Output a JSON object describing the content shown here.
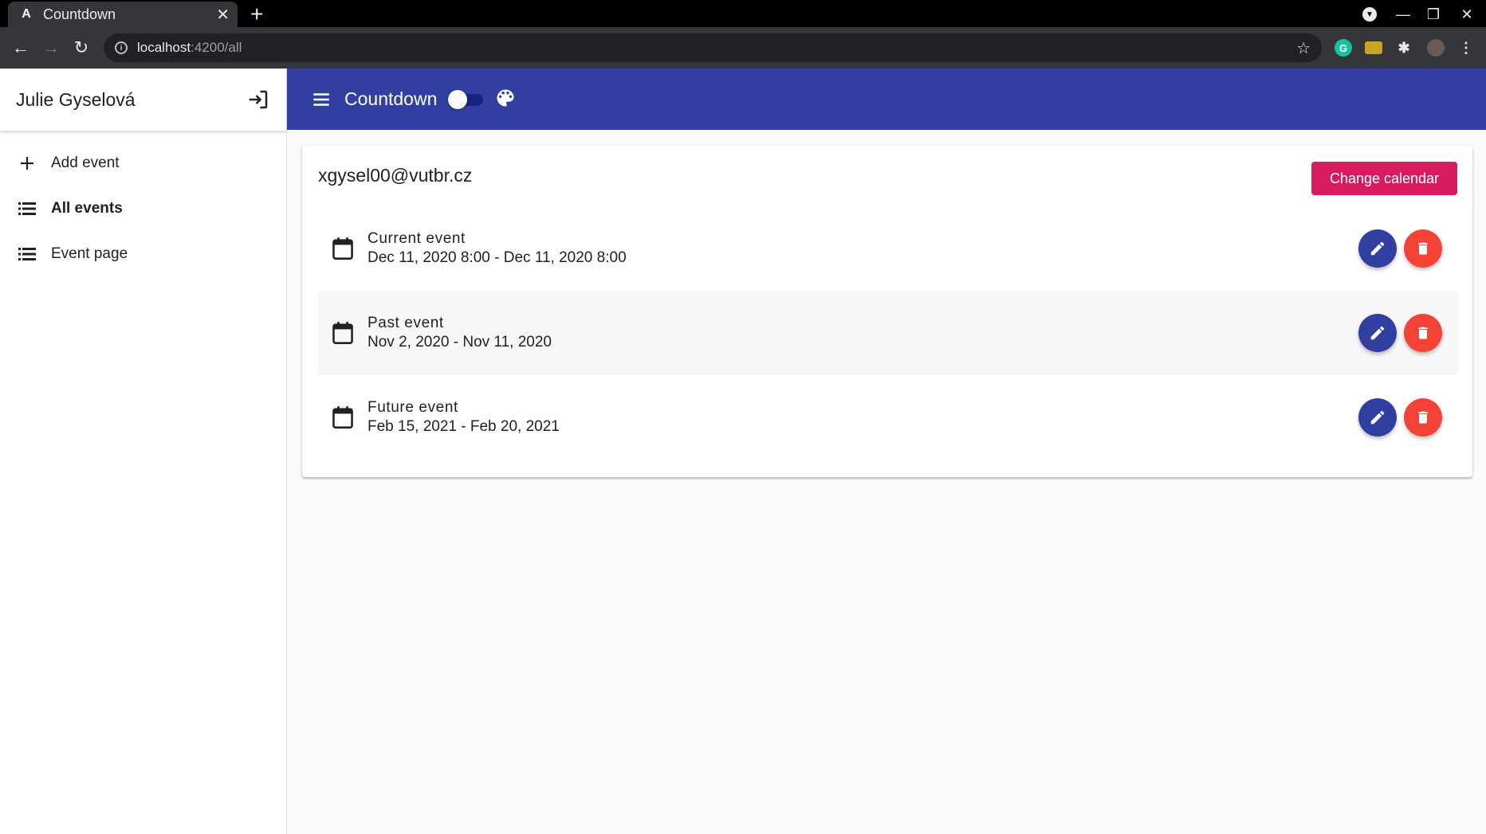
{
  "browser": {
    "tab_title": "Countdown",
    "tab_favicon": "A",
    "url_host": "localhost",
    "url_path": ":4200/all"
  },
  "sidebar": {
    "user_name": "Julie Gyselová",
    "items": [
      {
        "label": "Add event",
        "icon": "plus-icon",
        "active": false
      },
      {
        "label": "All events",
        "icon": "list-icon",
        "active": true
      },
      {
        "label": "Event page",
        "icon": "list-icon",
        "active": false
      }
    ]
  },
  "toolbar": {
    "title": "Countdown",
    "dark_mode": false
  },
  "main": {
    "calendar_email": "xgysel00@vutbr.cz",
    "change_calendar_label": "Change calendar",
    "events": [
      {
        "name": "Current event",
        "dates": "Dec 11, 2020 8:00 - Dec 11, 2020 8:00"
      },
      {
        "name": "Past event",
        "dates": "Nov 2, 2020 - Nov 11, 2020"
      },
      {
        "name": "Future event",
        "dates": "Feb 15, 2021 - Feb 20, 2021"
      }
    ]
  },
  "colors": {
    "primary": "#3140a0",
    "accent": "#d81b60",
    "warn": "#f44336"
  }
}
